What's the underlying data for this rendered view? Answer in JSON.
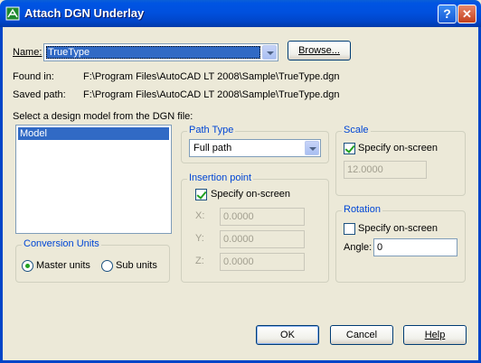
{
  "window": {
    "title": "Attach DGN Underlay",
    "help_glyph": "?",
    "close_glyph": "✕"
  },
  "name": {
    "label": "Name:",
    "value": "TrueType",
    "browse_label": "Browse..."
  },
  "found_in": {
    "label": "Found in:",
    "value": "F:\\Program Files\\AutoCAD LT 2008\\Sample\\TrueType.dgn"
  },
  "saved_path": {
    "label": "Saved path:",
    "value": "F:\\Program Files\\AutoCAD LT 2008\\Sample\\TrueType.dgn"
  },
  "design_model": {
    "label": "Select a design model from the DGN file:",
    "items": [
      "Model"
    ]
  },
  "conversion_units": {
    "title": "Conversion Units",
    "master_label": "Master units",
    "sub_label": "Sub units",
    "selected": "Master units"
  },
  "path_type": {
    "title": "Path Type",
    "value": "Full path"
  },
  "insertion_point": {
    "title": "Insertion point",
    "specify_label": "Specify on-screen",
    "specify_checked": true,
    "x_label": "X:",
    "x_value": "0.0000",
    "y_label": "Y:",
    "y_value": "0.0000",
    "z_label": "Z:",
    "z_value": "0.0000"
  },
  "scale": {
    "title": "Scale",
    "specify_label": "Specify on-screen",
    "specify_checked": true,
    "value": "12.0000"
  },
  "rotation": {
    "title": "Rotation",
    "specify_label": "Specify on-screen",
    "specify_checked": false,
    "angle_label": "Angle:",
    "angle_value": "0"
  },
  "buttons": {
    "ok": "OK",
    "cancel": "Cancel",
    "help": "Help"
  },
  "colors": {
    "title_bar": "#0054e3",
    "group_title": "#0046d5",
    "selection": "#316ac5",
    "dialog_bg": "#ece9d8"
  }
}
